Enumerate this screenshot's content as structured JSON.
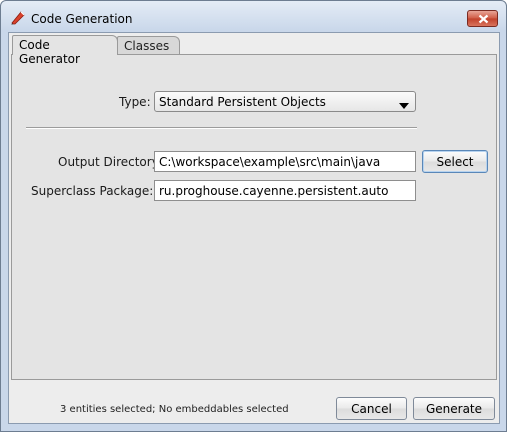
{
  "window": {
    "title": "Code Generation"
  },
  "tabs": [
    {
      "label": "Code Generator"
    },
    {
      "label": "Classes"
    }
  ],
  "form": {
    "type_label": "Type:",
    "type_value": "Standard Persistent Objects",
    "output_label": "Output Directory:",
    "output_value": "C:\\workspace\\example\\src\\main\\java",
    "select_label": "Select",
    "superclass_label": "Superclass Package:",
    "superclass_value": "ru.proghouse.cayenne.persistent.auto"
  },
  "footer": {
    "status": "3 entities selected; No embeddables selected",
    "cancel_label": "Cancel",
    "generate_label": "Generate"
  },
  "icons": {
    "app": "pencil-icon",
    "close": "close-icon",
    "dropdown": "dropdown-arrow-icon"
  }
}
